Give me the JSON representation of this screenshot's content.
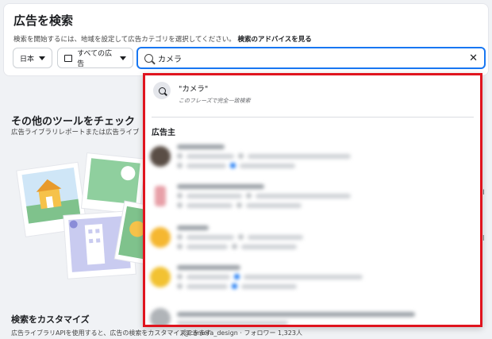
{
  "header": {
    "title": "広告を検索",
    "subtitle": "検索を開始するには、地域を設定して広告カテゴリを選択してください。",
    "advice_link": "検索のアドバイスを見る"
  },
  "filters": {
    "country": "日本",
    "category": "すべての広告"
  },
  "search": {
    "value": "カメラ"
  },
  "tools": {
    "title": "その他のツールをチェック",
    "subtitle": "広告ライブラリレポートまたは広告ライブ"
  },
  "customize": {
    "title": "検索をカスタマイズ",
    "subtitle": "広告ライブラリAPIを使用すると、広告の検索をカスタマイズできます"
  },
  "dropdown": {
    "phrase_title": "\"カメラ\"",
    "phrase_sub": "このフレーズで完全一致検索",
    "section_label": "広告主",
    "advertisers": [
      {
        "avatar_color": "#5a4e46"
      },
      {
        "avatar_color": "#e8a0a8"
      },
      {
        "avatar_color": "#f5b731"
      },
      {
        "avatar_color": "#f2c232"
      },
      {
        "avatar_color": "#b0b4b8"
      }
    ],
    "footer_text": "(@camera_design · フォロワー 1,323人"
  },
  "colors": {
    "accent": "#1877f2",
    "highlight_border": "#e0141e"
  }
}
